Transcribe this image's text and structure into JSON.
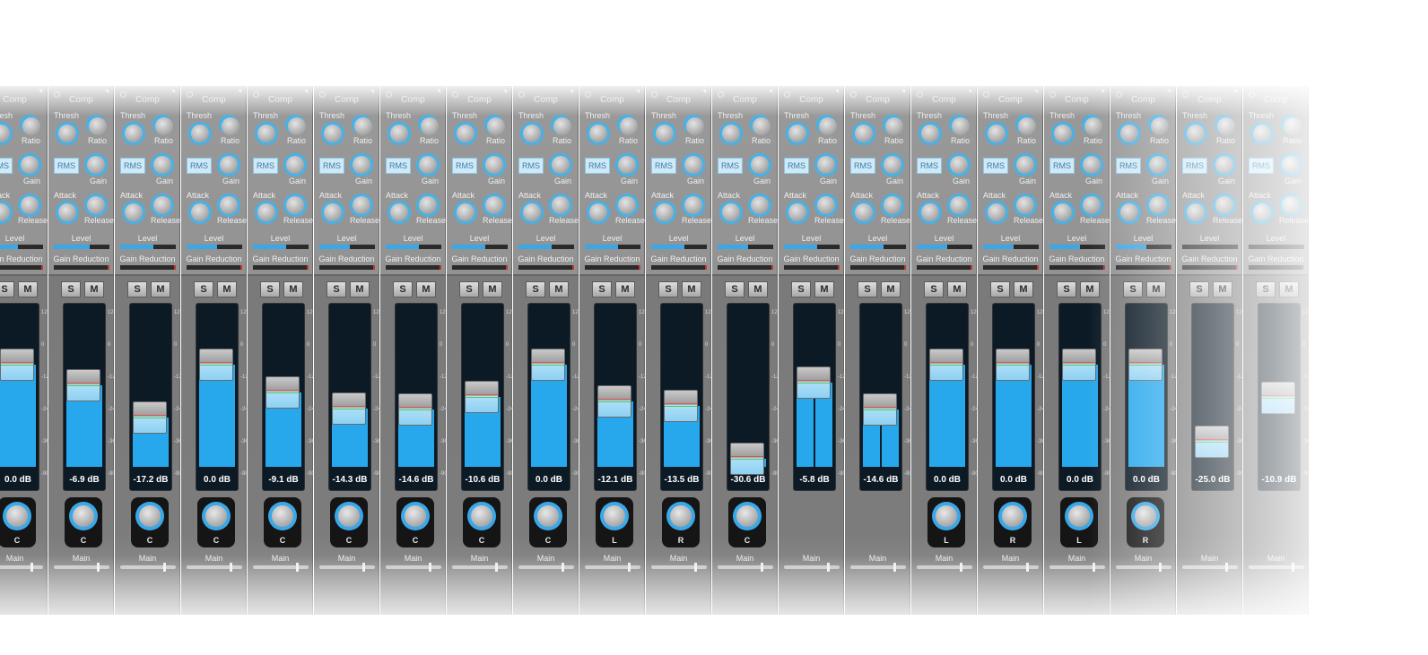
{
  "labels": {
    "comp": "Comp",
    "thresh": "Thresh",
    "ratio": "Ratio",
    "rms": "RMS",
    "gain": "Gain",
    "attack": "Attack",
    "release": "Release",
    "level": "Level",
    "gain_reduction": "Gain Reduction",
    "solo": "S",
    "mute": "M",
    "output": "Main"
  },
  "scale_ticks": [
    "12",
    "0",
    "-12",
    "-24",
    "-36",
    "-90"
  ],
  "colors": {
    "accent": "#3aa8e8",
    "fader_well": "#0c1a26",
    "strip": "#929292"
  },
  "channels": [
    {
      "db": "0.0 dB",
      "fader_db": 0.0,
      "pan": "C",
      "level": 0.55,
      "stereo": false
    },
    {
      "db": "-6.9 dB",
      "fader_db": -6.9,
      "pan": "C",
      "level": 0.65,
      "stereo": false
    },
    {
      "db": "-17.2 dB",
      "fader_db": -17.2,
      "pan": "C",
      "level": 0.6,
      "stereo": false
    },
    {
      "db": "0.0 dB",
      "fader_db": 0.0,
      "pan": "C",
      "level": 0.55,
      "stereo": false
    },
    {
      "db": "-9.1 dB",
      "fader_db": -9.1,
      "pan": "C",
      "level": 0.6,
      "stereo": false
    },
    {
      "db": "-14.3 dB",
      "fader_db": -14.3,
      "pan": "C",
      "level": 0.55,
      "stereo": false
    },
    {
      "db": "-14.6 dB",
      "fader_db": -14.6,
      "pan": "C",
      "level": 0.6,
      "stereo": false
    },
    {
      "db": "-10.6 dB",
      "fader_db": -10.6,
      "pan": "C",
      "level": 0.6,
      "stereo": false
    },
    {
      "db": "0.0 dB",
      "fader_db": 0.0,
      "pan": "C",
      "level": 0.6,
      "stereo": false
    },
    {
      "db": "-12.1 dB",
      "fader_db": -12.1,
      "pan": "L",
      "level": 0.6,
      "stereo": false
    },
    {
      "db": "-13.5 dB",
      "fader_db": -13.5,
      "pan": "R",
      "level": 0.6,
      "stereo": false
    },
    {
      "db": "-30.6 dB",
      "fader_db": -30.6,
      "pan": "C",
      "level": 0.55,
      "stereo": false
    },
    {
      "db": "-5.8 dB",
      "fader_db": -5.8,
      "pan": "",
      "level": 0.6,
      "stereo": true
    },
    {
      "db": "-14.6 dB",
      "fader_db": -14.6,
      "pan": "",
      "level": 0.6,
      "stereo": true
    },
    {
      "db": "0.0 dB",
      "fader_db": 0.0,
      "pan": "L",
      "level": 0.55,
      "stereo": false
    },
    {
      "db": "0.0 dB",
      "fader_db": 0.0,
      "pan": "R",
      "level": 0.55,
      "stereo": false
    },
    {
      "db": "0.0 dB",
      "fader_db": 0.0,
      "pan": "L",
      "level": 0.55,
      "stereo": false
    },
    {
      "db": "0.0 dB",
      "fader_db": 0.0,
      "pan": "R",
      "level": 0.55,
      "stereo": false
    },
    {
      "db": "-25.0 dB",
      "fader_db": -25.0,
      "pan": "",
      "level": 0.0,
      "stereo": false
    },
    {
      "db": "-10.9 dB",
      "fader_db": -10.9,
      "pan": "",
      "level": 0.0,
      "stereo": false
    }
  ]
}
